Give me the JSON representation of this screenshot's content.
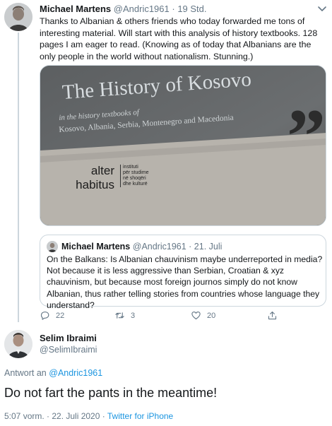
{
  "tweet": {
    "author": {
      "name": "Michael Martens",
      "handle": "@Andric1961",
      "time": "· 19 Std."
    },
    "text": "Thanks to Albanian & others friends who today forwarded me tons of interesting material. Will start with this analysis of history textbooks. 128 pages I am eager to read. (Knowing as of today that Albanians are the only people in the world without nationalism. Stunning.)",
    "photo": {
      "title": "The History of Kosovo",
      "subtitle_1": "in the history textbooks of",
      "subtitle_2": "Kosovo, Albania, Serbia, Montenegro and Macedonia",
      "logo_alter": "alter",
      "logo_habitus": "habitus",
      "logo_institute_lines": [
        "instituti",
        "për studime",
        "në shoqëri",
        "dhe kulturë"
      ]
    },
    "quoted": {
      "name": "Michael Martens",
      "handle": "@Andric1961",
      "time": "· 21. Juli",
      "text": "On the Balkans: Is Albanian chauvinism maybe underreported in media? Not because it is less aggressive than Serbian, Croatian & xyz chauvinism, but because most foreign journos simply do not know Albanian, thus rather telling stories from countries whose language they understand?"
    },
    "actions": {
      "replies": "22",
      "retweets": "3",
      "likes": "20"
    }
  },
  "reply": {
    "name": "Selim Ibraimi",
    "handle": "@SelimIbraimi",
    "reply_prefix": "Antwort an",
    "reply_target": "@Andric1961",
    "text": "Do not fart the pants in the meantime!",
    "timestamp": "5:07 vorm. · 22. Juli 2020 ·",
    "source": "Twitter for iPhone"
  },
  "colors": {
    "link": "#1b95e0",
    "secondary_text": "#657786",
    "border": "#ccd6dd"
  }
}
